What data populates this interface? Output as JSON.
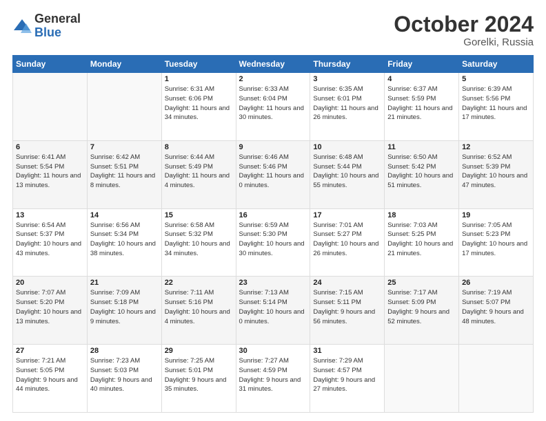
{
  "logo": {
    "general": "General",
    "blue": "Blue"
  },
  "header": {
    "month": "October 2024",
    "location": "Gorelki, Russia"
  },
  "weekdays": [
    "Sunday",
    "Monday",
    "Tuesday",
    "Wednesday",
    "Thursday",
    "Friday",
    "Saturday"
  ],
  "weeks": [
    [
      {
        "day": "",
        "info": ""
      },
      {
        "day": "",
        "info": ""
      },
      {
        "day": "1",
        "info": "Sunrise: 6:31 AM\nSunset: 6:06 PM\nDaylight: 11 hours and 34 minutes."
      },
      {
        "day": "2",
        "info": "Sunrise: 6:33 AM\nSunset: 6:04 PM\nDaylight: 11 hours and 30 minutes."
      },
      {
        "day": "3",
        "info": "Sunrise: 6:35 AM\nSunset: 6:01 PM\nDaylight: 11 hours and 26 minutes."
      },
      {
        "day": "4",
        "info": "Sunrise: 6:37 AM\nSunset: 5:59 PM\nDaylight: 11 hours and 21 minutes."
      },
      {
        "day": "5",
        "info": "Sunrise: 6:39 AM\nSunset: 5:56 PM\nDaylight: 11 hours and 17 minutes."
      }
    ],
    [
      {
        "day": "6",
        "info": "Sunrise: 6:41 AM\nSunset: 5:54 PM\nDaylight: 11 hours and 13 minutes."
      },
      {
        "day": "7",
        "info": "Sunrise: 6:42 AM\nSunset: 5:51 PM\nDaylight: 11 hours and 8 minutes."
      },
      {
        "day": "8",
        "info": "Sunrise: 6:44 AM\nSunset: 5:49 PM\nDaylight: 11 hours and 4 minutes."
      },
      {
        "day": "9",
        "info": "Sunrise: 6:46 AM\nSunset: 5:46 PM\nDaylight: 11 hours and 0 minutes."
      },
      {
        "day": "10",
        "info": "Sunrise: 6:48 AM\nSunset: 5:44 PM\nDaylight: 10 hours and 55 minutes."
      },
      {
        "day": "11",
        "info": "Sunrise: 6:50 AM\nSunset: 5:42 PM\nDaylight: 10 hours and 51 minutes."
      },
      {
        "day": "12",
        "info": "Sunrise: 6:52 AM\nSunset: 5:39 PM\nDaylight: 10 hours and 47 minutes."
      }
    ],
    [
      {
        "day": "13",
        "info": "Sunrise: 6:54 AM\nSunset: 5:37 PM\nDaylight: 10 hours and 43 minutes."
      },
      {
        "day": "14",
        "info": "Sunrise: 6:56 AM\nSunset: 5:34 PM\nDaylight: 10 hours and 38 minutes."
      },
      {
        "day": "15",
        "info": "Sunrise: 6:58 AM\nSunset: 5:32 PM\nDaylight: 10 hours and 34 minutes."
      },
      {
        "day": "16",
        "info": "Sunrise: 6:59 AM\nSunset: 5:30 PM\nDaylight: 10 hours and 30 minutes."
      },
      {
        "day": "17",
        "info": "Sunrise: 7:01 AM\nSunset: 5:27 PM\nDaylight: 10 hours and 26 minutes."
      },
      {
        "day": "18",
        "info": "Sunrise: 7:03 AM\nSunset: 5:25 PM\nDaylight: 10 hours and 21 minutes."
      },
      {
        "day": "19",
        "info": "Sunrise: 7:05 AM\nSunset: 5:23 PM\nDaylight: 10 hours and 17 minutes."
      }
    ],
    [
      {
        "day": "20",
        "info": "Sunrise: 7:07 AM\nSunset: 5:20 PM\nDaylight: 10 hours and 13 minutes."
      },
      {
        "day": "21",
        "info": "Sunrise: 7:09 AM\nSunset: 5:18 PM\nDaylight: 10 hours and 9 minutes."
      },
      {
        "day": "22",
        "info": "Sunrise: 7:11 AM\nSunset: 5:16 PM\nDaylight: 10 hours and 4 minutes."
      },
      {
        "day": "23",
        "info": "Sunrise: 7:13 AM\nSunset: 5:14 PM\nDaylight: 10 hours and 0 minutes."
      },
      {
        "day": "24",
        "info": "Sunrise: 7:15 AM\nSunset: 5:11 PM\nDaylight: 9 hours and 56 minutes."
      },
      {
        "day": "25",
        "info": "Sunrise: 7:17 AM\nSunset: 5:09 PM\nDaylight: 9 hours and 52 minutes."
      },
      {
        "day": "26",
        "info": "Sunrise: 7:19 AM\nSunset: 5:07 PM\nDaylight: 9 hours and 48 minutes."
      }
    ],
    [
      {
        "day": "27",
        "info": "Sunrise: 7:21 AM\nSunset: 5:05 PM\nDaylight: 9 hours and 44 minutes."
      },
      {
        "day": "28",
        "info": "Sunrise: 7:23 AM\nSunset: 5:03 PM\nDaylight: 9 hours and 40 minutes."
      },
      {
        "day": "29",
        "info": "Sunrise: 7:25 AM\nSunset: 5:01 PM\nDaylight: 9 hours and 35 minutes."
      },
      {
        "day": "30",
        "info": "Sunrise: 7:27 AM\nSunset: 4:59 PM\nDaylight: 9 hours and 31 minutes."
      },
      {
        "day": "31",
        "info": "Sunrise: 7:29 AM\nSunset: 4:57 PM\nDaylight: 9 hours and 27 minutes."
      },
      {
        "day": "",
        "info": ""
      },
      {
        "day": "",
        "info": ""
      }
    ]
  ]
}
